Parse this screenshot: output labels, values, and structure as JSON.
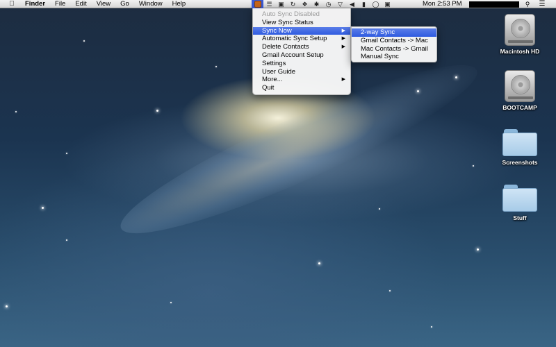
{
  "menubar": {
    "app_name": "Finder",
    "menus": [
      "File",
      "Edit",
      "View",
      "Go",
      "Window",
      "Help"
    ],
    "clock": "Mon 2:53 PM"
  },
  "status_icons": [
    "sync-contacts-icon",
    "clipboard-icon",
    "airplay-icon",
    "refresh-icon",
    "dropbox-icon",
    "bluetooth-icon",
    "time-machine-icon",
    "wifi-icon",
    "volume-icon",
    "battery-icon",
    "chat-icon",
    "input-menu-icon"
  ],
  "sync_menu": {
    "items": [
      {
        "label": "Auto Sync Disabled",
        "disabled": true,
        "submenu": false
      },
      {
        "label": "View Sync Status",
        "disabled": false,
        "submenu": false
      },
      {
        "label": "Sync Now",
        "disabled": false,
        "submenu": true,
        "highlighted": true
      },
      {
        "label": "Automatic Sync Setup",
        "disabled": false,
        "submenu": true
      },
      {
        "label": "Delete Contacts",
        "disabled": false,
        "submenu": true
      },
      {
        "label": "Gmail Account Setup",
        "disabled": false,
        "submenu": false
      },
      {
        "label": "Settings",
        "disabled": false,
        "submenu": false
      },
      {
        "label": "User Guide",
        "disabled": false,
        "submenu": false
      },
      {
        "label": "More...",
        "disabled": false,
        "submenu": true
      },
      {
        "label": "Quit",
        "disabled": false,
        "submenu": false
      }
    ],
    "submenu_items": [
      {
        "label": "2-way Sync",
        "highlighted": true
      },
      {
        "label": "Gmail Contacts -> Mac"
      },
      {
        "label": "Mac Contacts -> Gmail"
      },
      {
        "label": "Manual Sync"
      }
    ]
  },
  "desktop_icons": [
    {
      "label": "Macintosh HD",
      "kind": "hard-drive"
    },
    {
      "label": "BOOTCAMP",
      "kind": "hard-drive"
    },
    {
      "label": "Screenshots",
      "kind": "folder"
    },
    {
      "label": "Stuff",
      "kind": "folder"
    }
  ]
}
